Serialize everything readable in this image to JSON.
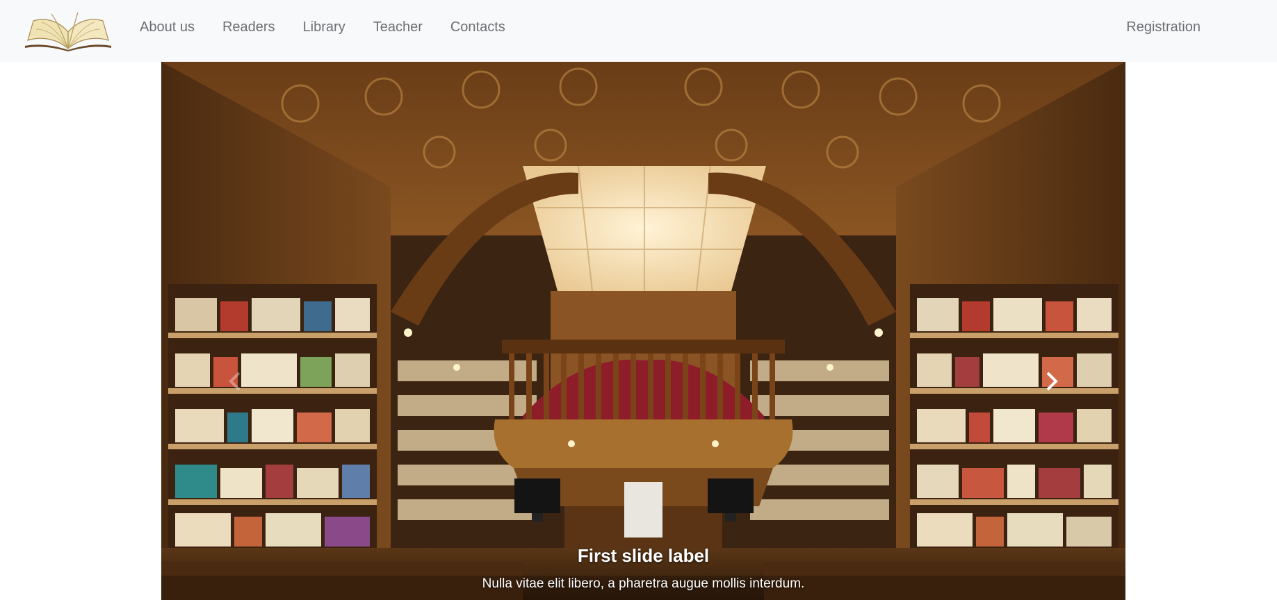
{
  "navbar": {
    "logo_icon": "open-book-icon",
    "links": [
      {
        "label": "About us"
      },
      {
        "label": "Readers"
      },
      {
        "label": "Library"
      },
      {
        "label": "Teacher"
      },
      {
        "label": "Contacts"
      }
    ],
    "right_link": {
      "label": "Registration"
    }
  },
  "carousel": {
    "image_icon": "library-interior-photo",
    "prev_icon": "chevron-left-icon",
    "next_icon": "chevron-right-icon",
    "caption": {
      "title": "First slide label",
      "text": "Nulla vitae elit libero, a pharetra augue mollis interdum."
    }
  },
  "colors": {
    "navbar_bg": "#f8f9fa",
    "nav_text": "#6c6f73",
    "caption_text": "#ffffff"
  }
}
